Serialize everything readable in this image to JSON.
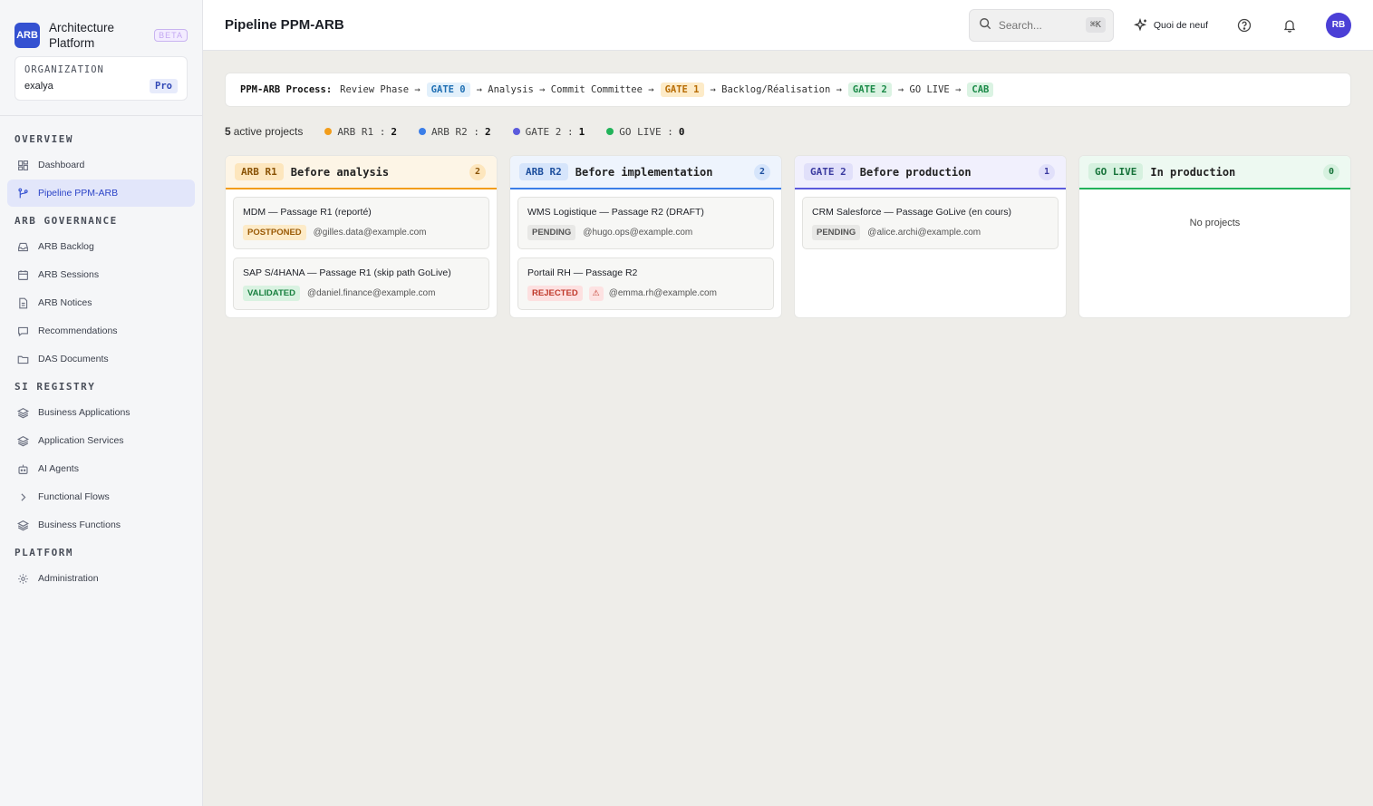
{
  "brand": {
    "logo": "ARB",
    "name": "Architecture Platform",
    "badge": "BETA"
  },
  "organization": {
    "label": "ORGANIZATION",
    "name": "exalya",
    "plan": "Pro"
  },
  "sidebar": {
    "sections": [
      {
        "title": "OVERVIEW",
        "items": [
          {
            "label": "Dashboard",
            "icon": "dashboard-icon"
          },
          {
            "label": "Pipeline PPM-ARB",
            "icon": "pipeline-icon",
            "active": true
          }
        ]
      },
      {
        "title": "ARB GOVERNANCE",
        "items": [
          {
            "label": "ARB Backlog",
            "icon": "inbox-icon"
          },
          {
            "label": "ARB Sessions",
            "icon": "calendar-icon"
          },
          {
            "label": "ARB Notices",
            "icon": "document-icon"
          },
          {
            "label": "Recommendations",
            "icon": "message-icon"
          },
          {
            "label": "DAS Documents",
            "icon": "folder-icon"
          }
        ]
      },
      {
        "title": "SI REGISTRY",
        "items": [
          {
            "label": "Business Applications",
            "icon": "layers-icon"
          },
          {
            "label": "Application Services",
            "icon": "layers-icon"
          },
          {
            "label": "AI Agents",
            "icon": "bot-icon"
          },
          {
            "label": "Functional Flows",
            "icon": "chevron-right-icon"
          },
          {
            "label": "Business Functions",
            "icon": "layers-icon"
          }
        ]
      },
      {
        "title": "PLATFORM",
        "items": [
          {
            "label": "Administration",
            "icon": "gear-icon"
          }
        ]
      }
    ]
  },
  "header": {
    "title": "Pipeline PPM-ARB",
    "search_placeholder": "Search...",
    "search_shortcut": "⌘K",
    "whats_new": "Quoi de neuf",
    "avatar": "RB"
  },
  "process": {
    "label": "PPM-ARB Process:",
    "step1": "Review Phase →",
    "gate0": "GATE 0",
    "step2": "→ Analysis → Commit Committee →",
    "gate1": "GATE 1",
    "step3": "→ Backlog/Réalisation →",
    "gate2": "GATE 2",
    "step4": "→ GO LIVE →",
    "cab": "CAB"
  },
  "stats": {
    "count": "5",
    "label": "active projects",
    "items": [
      {
        "label": "ARB R1 :",
        "value": "2",
        "color": "#f29d1b"
      },
      {
        "label": "ARB R2 :",
        "value": "2",
        "color": "#3b7ee8"
      },
      {
        "label": "GATE 2 :",
        "value": "1",
        "color": "#5b5bdc"
      },
      {
        "label": "GO LIVE :",
        "value": "0",
        "color": "#22b35a"
      }
    ]
  },
  "columns": [
    {
      "tag": "ARB R1",
      "title": "Before analysis",
      "count": "2",
      "color": "#f29d1b",
      "cards": [
        {
          "title": "MDM — Passage R1 (reporté)",
          "status": "POSTPONED",
          "owner": "@gilles.data@example.com"
        },
        {
          "title": "SAP S/4HANA — Passage R1 (skip path GoLive)",
          "status": "VALIDATED",
          "owner": "@daniel.finance@example.com"
        }
      ]
    },
    {
      "tag": "ARB R2",
      "title": "Before implementation",
      "count": "2",
      "color": "#3b7ee8",
      "cards": [
        {
          "title": "WMS Logistique — Passage R2 (DRAFT)",
          "status": "PENDING",
          "owner": "@hugo.ops@example.com"
        },
        {
          "title": "Portail RH — Passage R2",
          "status": "REJECTED",
          "warning": "⚠",
          "owner": "@emma.rh@example.com"
        }
      ]
    },
    {
      "tag": "GATE 2",
      "title": "Before production",
      "count": "1",
      "color": "#5b5bdc",
      "cards": [
        {
          "title": "CRM Salesforce — Passage GoLive (en cours)",
          "status": "PENDING",
          "owner": "@alice.archi@example.com"
        }
      ]
    },
    {
      "tag": "GO LIVE",
      "title": "In production",
      "count": "0",
      "color": "#22b35a",
      "empty": "No projects"
    }
  ]
}
